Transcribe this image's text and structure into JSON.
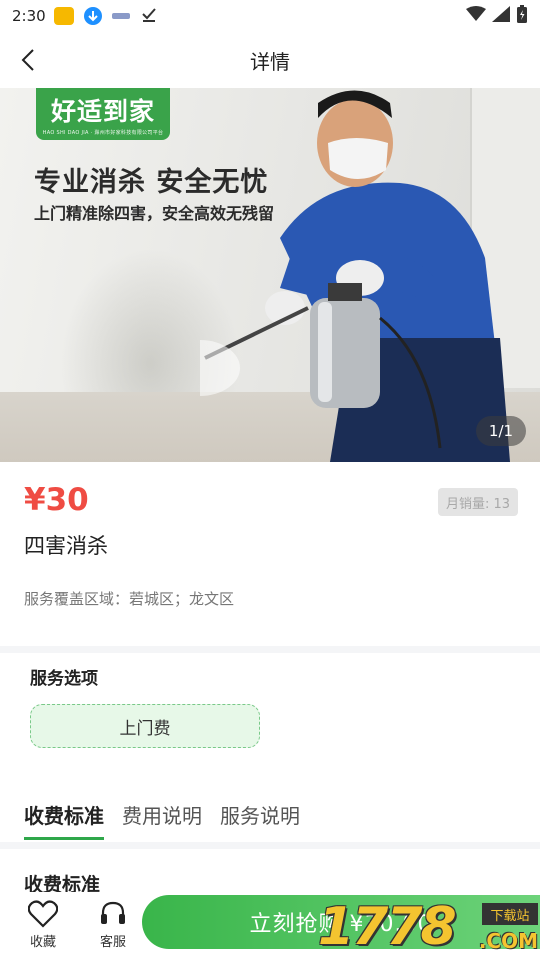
{
  "status_bar": {
    "time": "2:30"
  },
  "nav": {
    "title": "详情"
  },
  "hero": {
    "logo_text": "好适到家",
    "logo_subtext": "HAO SHI DAO JIA · 滁州市好家科技有限公司平台",
    "headline": "专业消杀 安全无忧",
    "subline": "上门精准除四害，安全高效无残留",
    "image_counter": "1/1"
  },
  "product": {
    "price": "¥30",
    "monthly_sales": "月销量: 13",
    "name": "四害消杀",
    "coverage": "服务覆盖区域：菪城区；龙文区"
  },
  "service_options": {
    "title": "服务选项",
    "options": [
      "上门费"
    ]
  },
  "tabs": [
    "收费标准",
    "费用说明",
    "服务说明"
  ],
  "content": {
    "section_title": "收费标准"
  },
  "bottom_bar": {
    "favorite_label": "收藏",
    "service_label": "客服",
    "buy_label": "立刻抢购 ¥30.00"
  },
  "watermark": {
    "number": "1778",
    "tag": "下载站",
    "domain": ".COM"
  },
  "colors": {
    "price_red": "#ef4c43",
    "brand_green": "#3aa34a",
    "tab_underline": "#2fa74a"
  }
}
